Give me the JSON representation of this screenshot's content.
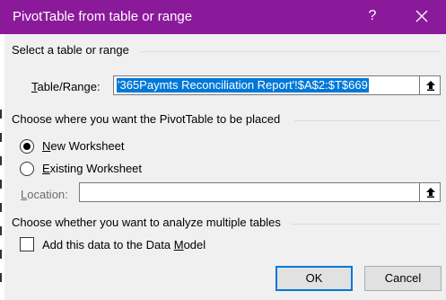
{
  "dialog": {
    "title": "PivotTable from table or range",
    "help_glyph": "?"
  },
  "select_section": {
    "heading": "Select a table or range",
    "range_label_accel": "T",
    "range_label_rest": "able/Range:",
    "range_value": "'365Paymts Reconciliation Report'!$A$2:$T$669"
  },
  "placement_section": {
    "heading": "Choose where you want the PivotTable to be placed",
    "new_worksheet_accel": "N",
    "new_worksheet_rest": "ew Worksheet",
    "new_worksheet_selected": true,
    "existing_worksheet_accel": "E",
    "existing_worksheet_rest": "xisting Worksheet",
    "location_label_accel": "L",
    "location_label_rest": "ocation:",
    "location_value": ""
  },
  "multiple_section": {
    "heading": "Choose whether you want to analyze multiple tables",
    "add_to_model_prefix": "Add this data to the Data ",
    "add_to_model_accel": "M",
    "add_to_model_rest": "odel",
    "add_to_model_checked": false
  },
  "buttons": {
    "ok": "OK",
    "cancel": "Cancel"
  },
  "colors": {
    "titlebar": "#8b1a9b",
    "selection": "#0078d7"
  },
  "icons": [
    "close-icon",
    "collapse-dialog-icon"
  ]
}
